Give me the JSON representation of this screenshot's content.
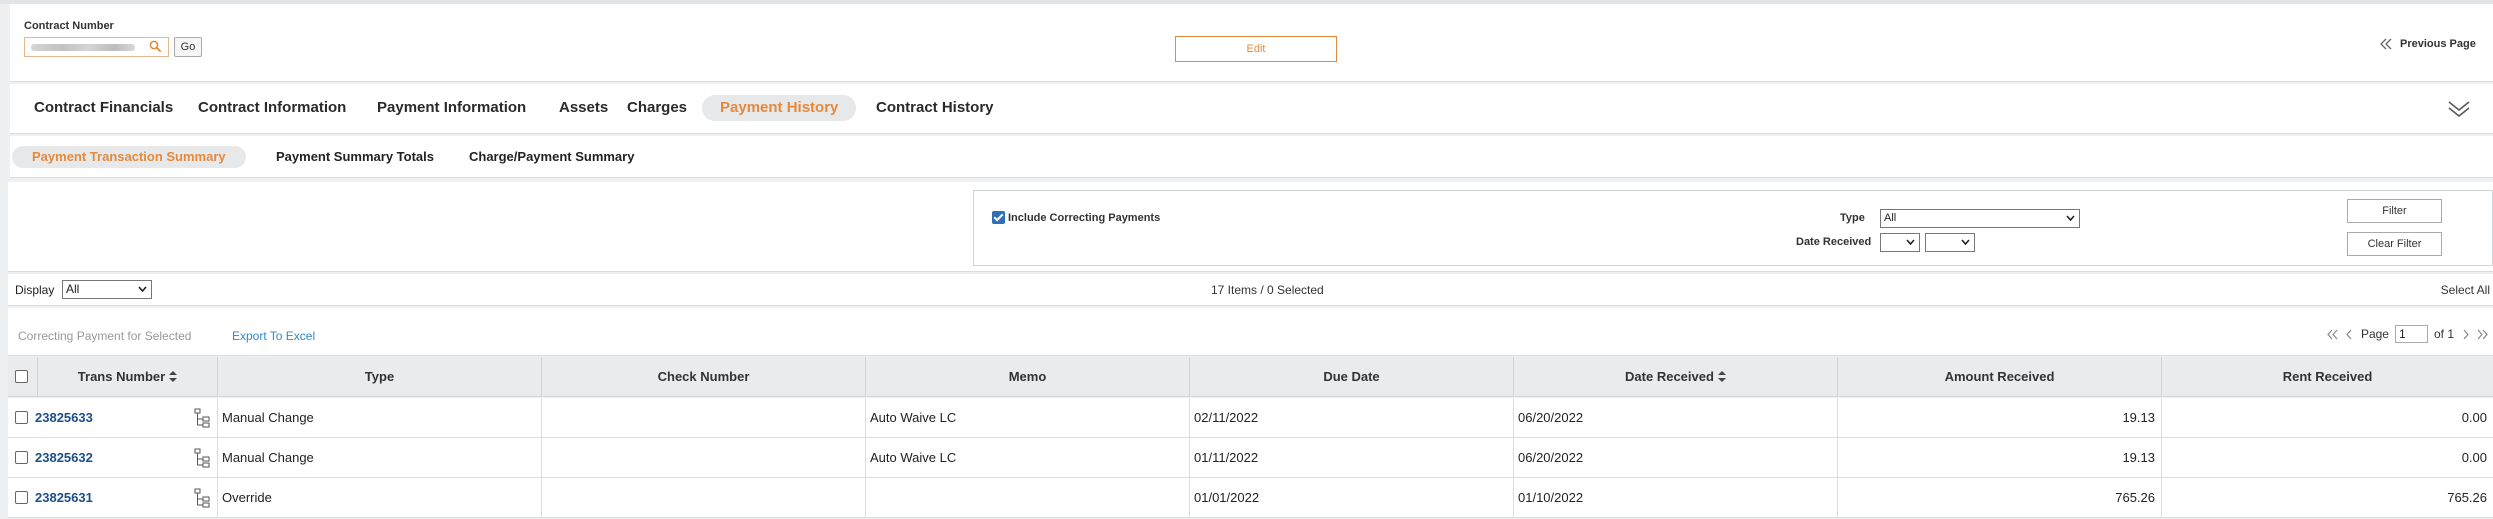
{
  "header": {
    "contract_number_label": "Contract Number",
    "contract_number_value": "",
    "go_label": "Go",
    "edit_label": "Edit",
    "previous_page_label": "Previous Page"
  },
  "tabs": [
    {
      "label": "Contract Financials",
      "active": false
    },
    {
      "label": "Contract Information",
      "active": false
    },
    {
      "label": "Payment Information",
      "active": false
    },
    {
      "label": "Assets",
      "active": false
    },
    {
      "label": "Charges",
      "active": false
    },
    {
      "label": "Payment History",
      "active": true
    },
    {
      "label": "Contract History",
      "active": false
    }
  ],
  "subtabs": [
    {
      "label": "Payment Transaction Summary",
      "active": true
    },
    {
      "label": "Payment Summary Totals",
      "active": false
    },
    {
      "label": "Charge/Payment Summary",
      "active": false
    }
  ],
  "filter": {
    "include_correcting_label": "Include Correcting Payments",
    "include_correcting_checked": true,
    "type_label": "Type",
    "type_value": "All",
    "date_received_label": "Date Received",
    "filter_button": "Filter",
    "clear_filter_button": "Clear Filter"
  },
  "display": {
    "label": "Display",
    "value": "All",
    "items_summary": "17 Items / 0 Selected",
    "select_all": "Select All"
  },
  "actions": {
    "correcting_payment": "Correcting Payment for Selected",
    "export": "Export To Excel"
  },
  "pager": {
    "page_label": "Page",
    "page_value": "1",
    "of_label": "of 1"
  },
  "table": {
    "columns": [
      "Trans Number",
      "Type",
      "Check Number",
      "Memo",
      "Due Date",
      "Date Received",
      "Amount Received",
      "Rent Received"
    ],
    "rows": [
      [
        "23825633",
        "Manual Change",
        "",
        "Auto Waive LC",
        "02/11/2022",
        "06/20/2022",
        "19.13",
        "0.00"
      ],
      [
        "23825632",
        "Manual Change",
        "",
        "Auto Waive LC",
        "01/11/2022",
        "06/20/2022",
        "19.13",
        "0.00"
      ],
      [
        "23825631",
        "Override",
        "",
        "",
        "01/01/2022",
        "01/10/2022",
        "765.26",
        "765.26"
      ]
    ]
  },
  "colors": {
    "accent": "#e58a3d",
    "link": "#2f8ad1",
    "trans_link": "#1b4f8a",
    "checkbox": "#2f6fb5"
  }
}
